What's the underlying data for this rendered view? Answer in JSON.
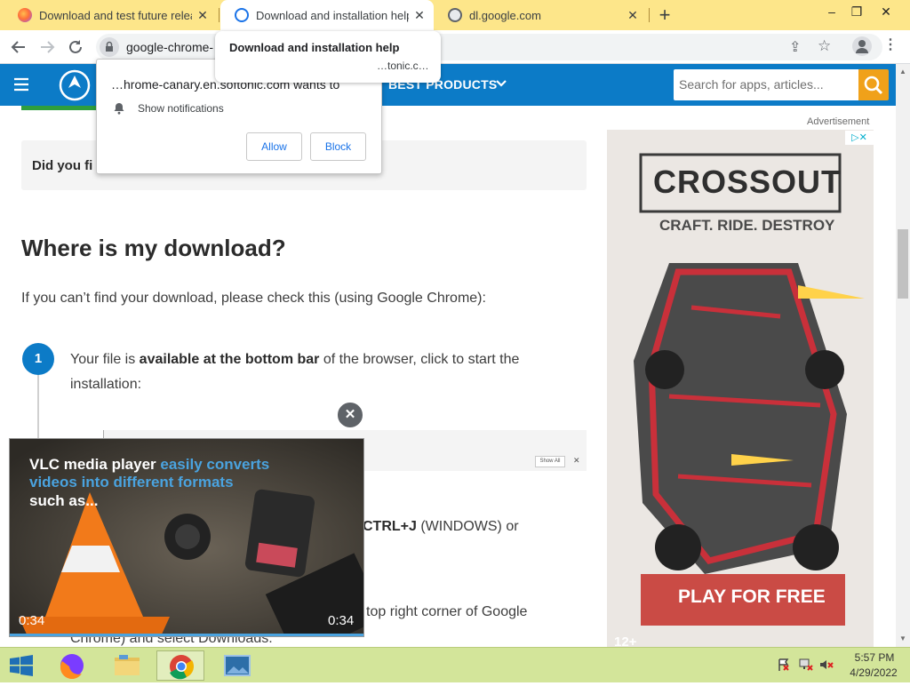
{
  "browser": {
    "tabs": [
      {
        "title": "Download and test future releas",
        "active": false
      },
      {
        "title": "Download and installation help",
        "active": true
      },
      {
        "title": "dl.google.com",
        "active": false
      }
    ],
    "new_tab": "+",
    "window_controls": {
      "minimize": "–",
      "restore": "❐",
      "close": "✕"
    },
    "address": "google-chrome-",
    "tooltip_title": "Download and installation help",
    "tooltip_url": "…tonic.c…"
  },
  "notification": {
    "title": "…hrome-canary.en.softonic.com wants to",
    "item": "Show notifications",
    "allow": "Allow",
    "block": "Block"
  },
  "site": {
    "nav_label": "BEST PRODUCTS",
    "search_placeholder": "Search for apps, articles...",
    "advertisement_label": "Advertisement"
  },
  "article": {
    "faq_prefix": "Did you fi",
    "heading": "Where is my download?",
    "intro": "If you can’t find your download, please check this (using Google Chrome):",
    "step1_number": "1",
    "step1_a": "Your file is ",
    "step1_b": "available at the bottom bar",
    "step1_c": " of the browser, click to start the",
    "step1_d": "installation:",
    "showall": "Show All",
    "step2_bold": "CTRL+J",
    "step2_rest": " (WINDOWS) or",
    "step3_tail": "top right corner of Google",
    "step3_line2": "Chrome) and select Downloads."
  },
  "video": {
    "close": "✕",
    "line1_white": "VLC media player ",
    "line1_blue": "easily converts",
    "line2_blue": "videos into different formats",
    "line3_white": "such as...",
    "time_left": "0:34",
    "time_right": "0:34"
  },
  "ad": {
    "brand": "CROSSOUT",
    "tagline": "CRAFT. RIDE. DESTROY",
    "cta": "PLAY FOR FREE",
    "rating": "12+",
    "ad_choices": "▷✕"
  },
  "taskbar": {
    "time": "5:57 PM",
    "date": "4/29/2022"
  },
  "colors": {
    "tabstrip": "#fde68a",
    "site_blue": "#0c7bc7",
    "search_orange": "#f0a11a",
    "vlc_blue": "#4aa3df",
    "taskbar": "#d3e59a"
  }
}
